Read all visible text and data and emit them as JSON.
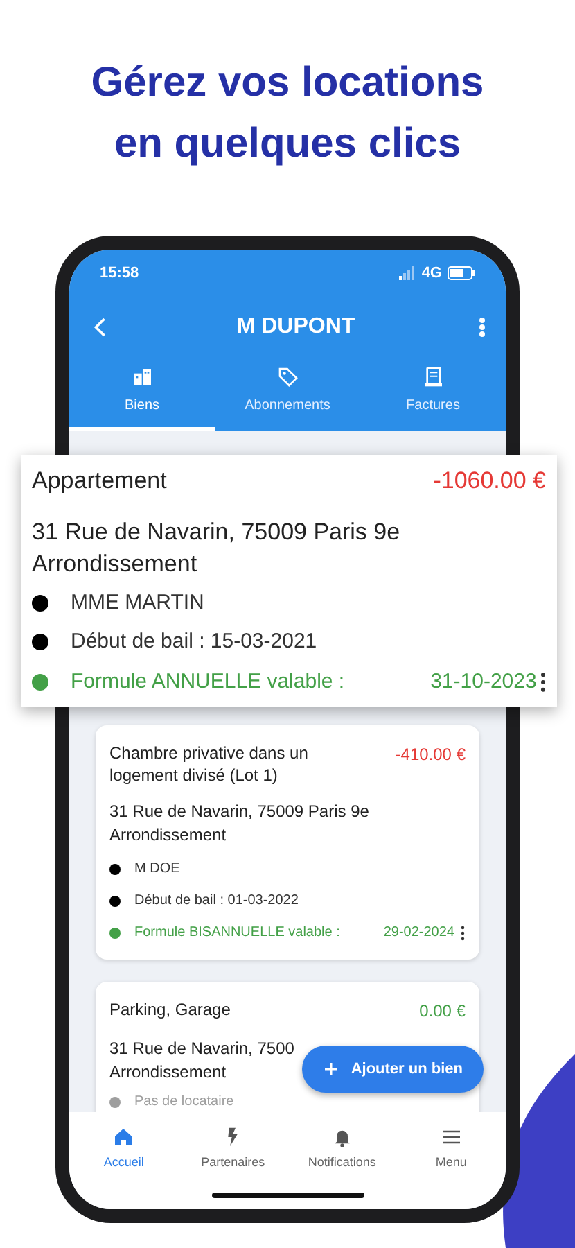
{
  "headline": [
    "Gérez vos locations",
    "en quelques clics"
  ],
  "status_bar": {
    "time": "15:58",
    "network": "4G"
  },
  "toolbar": {
    "title": "M DUPONT"
  },
  "tabs": [
    {
      "label": "Biens",
      "selected": true
    },
    {
      "label": "Abonnements",
      "selected": false
    },
    {
      "label": "Factures",
      "selected": false
    }
  ],
  "properties": [
    {
      "title": "Appartement",
      "amount": "-1060.00 €",
      "color": "#e53935",
      "address": "31 Rue de Navarin, 75009 Paris 9e Arrondissement",
      "details": [
        {
          "kind": "tenant",
          "text": "MME MARTIN",
          "color": "#000000"
        },
        {
          "kind": "lease",
          "text": "Début de bail : 15-03-2021",
          "color": "#000000"
        },
        {
          "kind": "formula",
          "text": "Formule ANNUELLE valable :",
          "date": "31-10-2023",
          "color": "#43a047"
        }
      ]
    },
    {
      "title": "Chambre privative dans un logement divisé (Lot 1)",
      "amount": "-410.00 €",
      "color": "#e53935",
      "address": "31 Rue de Navarin, 75009 Paris 9e Arrondissement",
      "details": [
        {
          "kind": "tenant",
          "text": "M DOE",
          "color": "#000000"
        },
        {
          "kind": "lease",
          "text": "Début de bail : 01-03-2022",
          "color": "#000000"
        },
        {
          "kind": "formula",
          "text": "Formule BISANNUELLE valable :",
          "date": "29-02-2024",
          "color": "#43a047"
        }
      ]
    },
    {
      "title": "Parking, Garage",
      "amount": "0.00 €",
      "color": "#43a047",
      "address": "31 Rue de Navarin, 7500",
      "address_line_2": "Arrondissement",
      "details": [
        {
          "kind": "empty",
          "text": "Pas de locataire",
          "color": "#9e9e9e"
        }
      ]
    }
  ],
  "fab": {
    "label": "Ajouter un bien"
  },
  "bottom_nav": [
    {
      "label": "Accueil",
      "selected": true
    },
    {
      "label": "Partenaires",
      "selected": false
    },
    {
      "label": "Notifications",
      "selected": false
    },
    {
      "label": "Menu",
      "selected": false
    }
  ]
}
